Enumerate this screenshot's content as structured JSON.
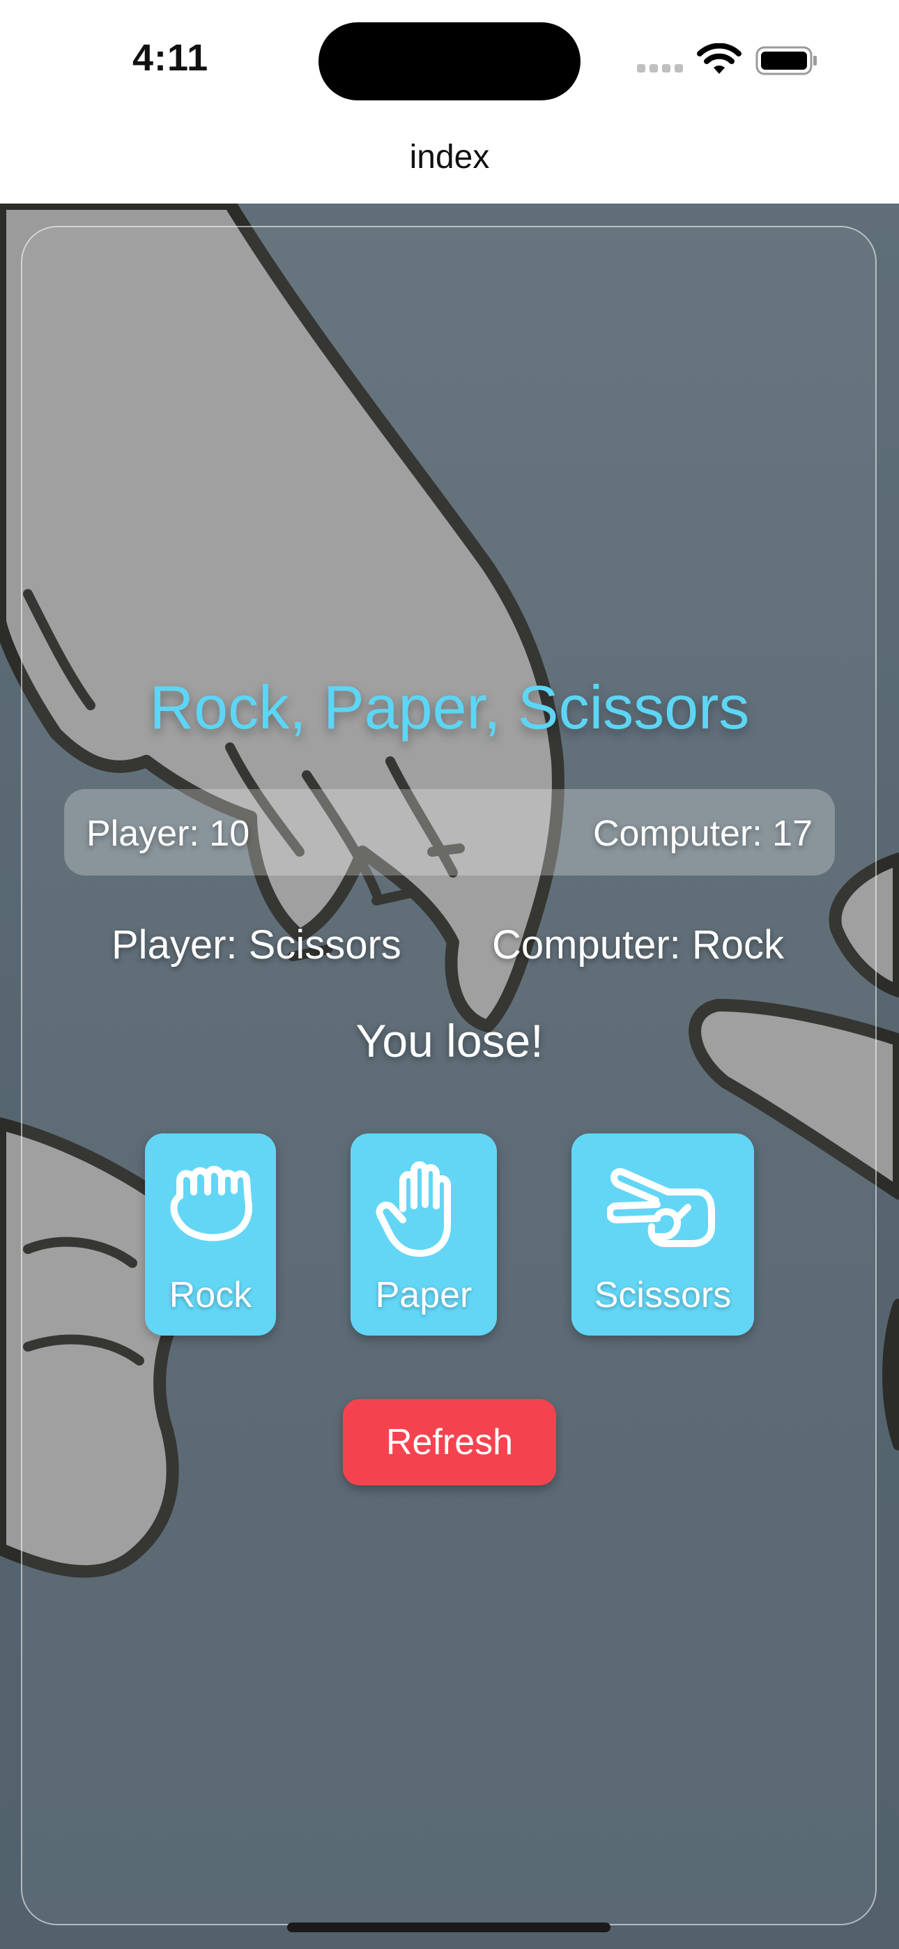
{
  "status_bar": {
    "time": "4:11",
    "icons": [
      "cellular-signal-icon",
      "wifi-icon",
      "battery-icon"
    ]
  },
  "nav": {
    "title": "index"
  },
  "game": {
    "title": "Rock, Paper, Scissors",
    "score": {
      "player": "Player: 10",
      "computer": "Computer: 17"
    },
    "choices": {
      "player": "Player: Scissors",
      "computer": "Computer: Rock"
    },
    "result": "You lose!",
    "moves": [
      {
        "label": "Rock",
        "icon": "rock-hand-icon"
      },
      {
        "label": "Paper",
        "icon": "paper-hand-icon"
      },
      {
        "label": "Scissors",
        "icon": "scissors-hand-icon"
      }
    ],
    "refresh_label": "Refresh"
  },
  "colors": {
    "accent": "#63d6f6",
    "title": "#5dd5f5",
    "danger": "#f4434f",
    "background": "#5b6a74"
  }
}
